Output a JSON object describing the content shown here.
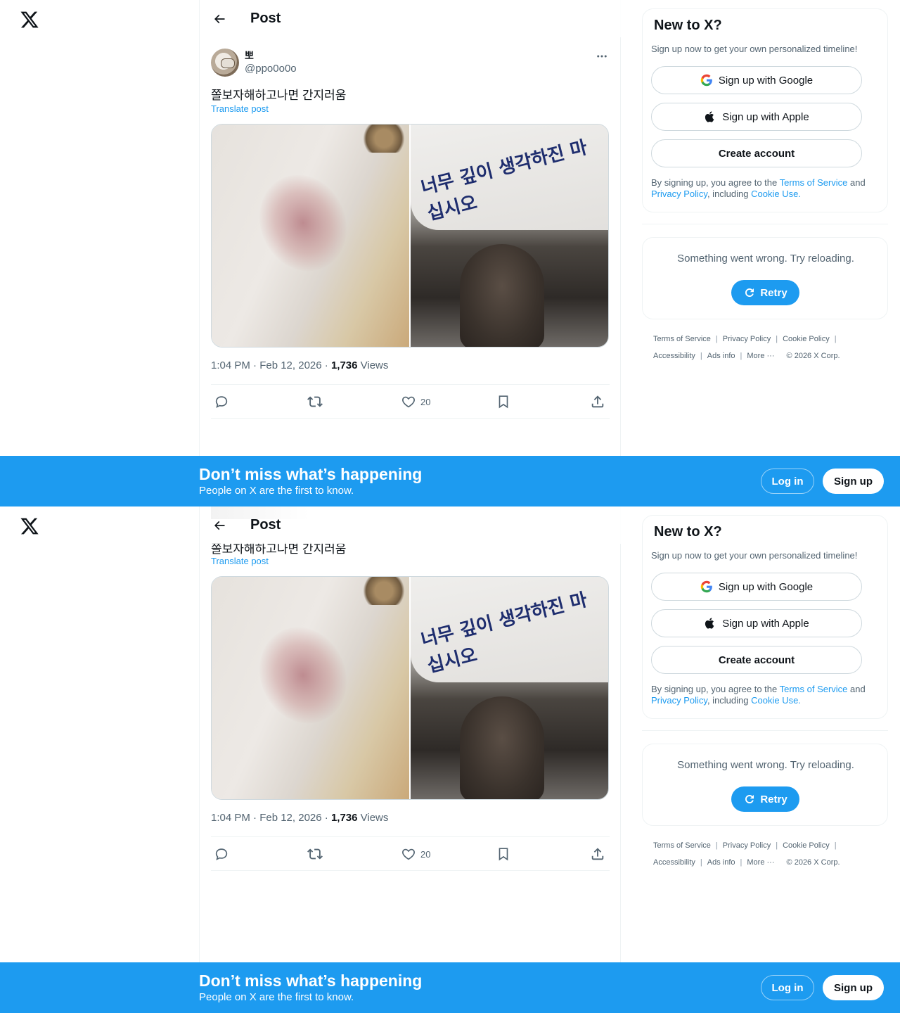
{
  "header": {
    "title": "Post"
  },
  "post": {
    "display_name": "뽀",
    "handle": "@ppo0o0o",
    "text": "쫄보자해하고나면 간지러움",
    "translate": "Translate post",
    "image_right_text": "너무 깊이 생각하진 마십시오",
    "time": "1:04 PM · Feb 12, 2026 · ",
    "views_count": "1,736",
    "views_label": " Views",
    "likes": "20"
  },
  "signup": {
    "title": "New to X?",
    "subtitle": "Sign up now to get your own personalized timeline!",
    "google": "Sign up with Google",
    "apple": "Sign up with Apple",
    "create": "Create account",
    "legal_1": "By signing up, you agree to the ",
    "terms": "Terms of Service",
    "legal_2": " and ",
    "privacy": "Privacy Policy",
    "legal_3": ", including ",
    "cookie": "Cookie Use."
  },
  "error": {
    "message": "Something went wrong. Try reloading.",
    "retry": "Retry"
  },
  "footer": {
    "terms": "Terms of Service",
    "privacy": "Privacy Policy",
    "cookie": "Cookie Policy",
    "accessibility": "Accessibility",
    "ads": "Ads info",
    "more": "More ···",
    "copyright": "© 2026 X Corp."
  },
  "banner": {
    "title": "Don’t miss what’s happening",
    "subtitle": "People on X are the first to know.",
    "login": "Log in",
    "signup": "Sign up"
  },
  "icons": {
    "logo": "x-logo-icon",
    "back": "arrow-left-icon",
    "more": "more-horizontal-icon",
    "reply": "reply-icon",
    "repost": "repost-icon",
    "like": "heart-icon",
    "bookmark": "bookmark-icon",
    "share": "share-icon",
    "google": "google-icon",
    "apple": "apple-icon",
    "retry": "refresh-icon"
  },
  "colors": {
    "accent": "#1d9bf0",
    "text": "#0f1419",
    "muted": "#536471"
  }
}
